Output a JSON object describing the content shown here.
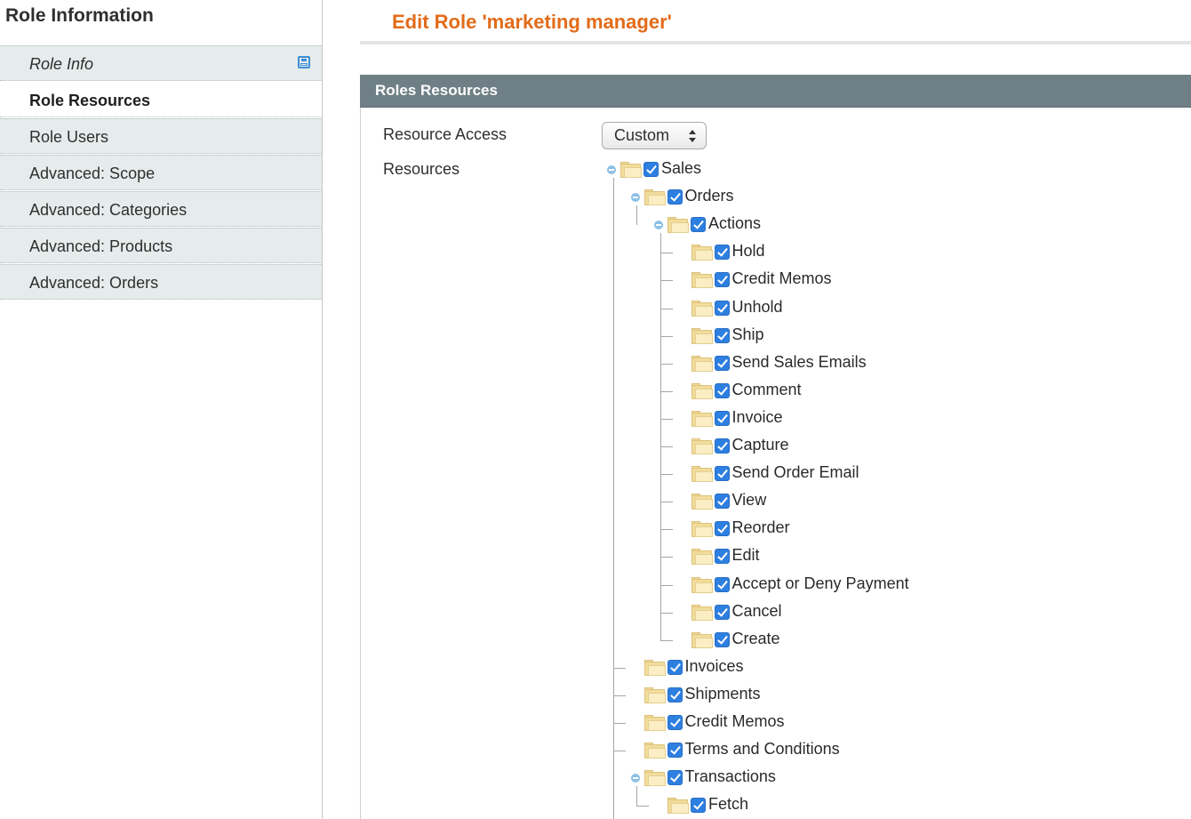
{
  "sidebar": {
    "title": "Role Information",
    "tabs": [
      {
        "label": "Role Info",
        "name": "tab-role-info"
      },
      {
        "label": "Role Resources",
        "name": "tab-role-resources"
      },
      {
        "label": "Role Users",
        "name": "tab-role-users"
      },
      {
        "label": "Advanced: Scope",
        "name": "tab-advanced-scope"
      },
      {
        "label": "Advanced: Categories",
        "name": "tab-advanced-categories"
      },
      {
        "label": "Advanced: Products",
        "name": "tab-advanced-products"
      },
      {
        "label": "Advanced: Orders",
        "name": "tab-advanced-orders"
      }
    ],
    "active_tab": "Role Resources"
  },
  "main": {
    "title": "Edit Role 'marketing manager'",
    "section_title": "Roles Resources",
    "resource_access_label": "Resource Access",
    "resource_access_value": "Custom",
    "resources_label": "Resources"
  },
  "tree": {
    "label": "Sales",
    "checked": true,
    "expanded": true,
    "children": [
      {
        "label": "Orders",
        "checked": true,
        "expanded": true,
        "children": [
          {
            "label": "Actions",
            "checked": true,
            "expanded": true,
            "children": [
              {
                "label": "Hold",
                "checked": true
              },
              {
                "label": "Credit Memos",
                "checked": true
              },
              {
                "label": "Unhold",
                "checked": true
              },
              {
                "label": "Ship",
                "checked": true
              },
              {
                "label": "Send Sales Emails",
                "checked": true
              },
              {
                "label": "Comment",
                "checked": true
              },
              {
                "label": "Invoice",
                "checked": true
              },
              {
                "label": "Capture",
                "checked": true
              },
              {
                "label": "Send Order Email",
                "checked": true
              },
              {
                "label": "View",
                "checked": true
              },
              {
                "label": "Reorder",
                "checked": true
              },
              {
                "label": "Edit",
                "checked": true
              },
              {
                "label": "Accept or Deny Payment",
                "checked": true
              },
              {
                "label": "Cancel",
                "checked": true
              },
              {
                "label": "Create",
                "checked": true
              }
            ]
          }
        ]
      },
      {
        "label": "Invoices",
        "checked": true
      },
      {
        "label": "Shipments",
        "checked": true
      },
      {
        "label": "Credit Memos",
        "checked": true
      },
      {
        "label": "Terms and Conditions",
        "checked": true
      },
      {
        "label": "Transactions",
        "checked": true,
        "expanded": true,
        "children": [
          {
            "label": "Fetch",
            "checked": true
          }
        ]
      }
    ]
  },
  "colors": {
    "title_accent": "#e26b19",
    "section_header_bg": "#6f7f86",
    "tab_bg": "#e6ecec",
    "checkbox": "#2d7fe0"
  }
}
